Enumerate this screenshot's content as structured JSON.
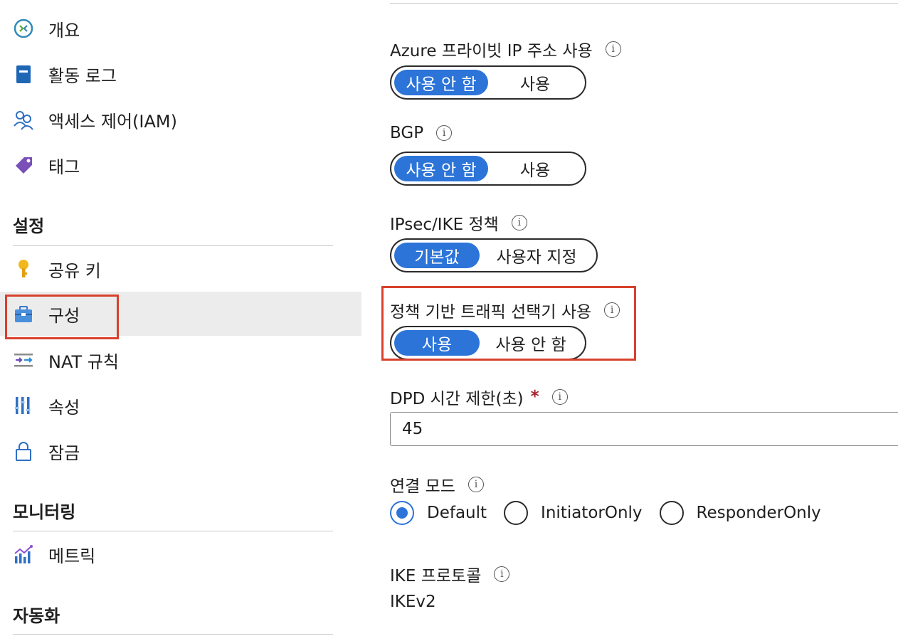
{
  "sidebar": {
    "items_top": [
      {
        "label": "개요",
        "icon": "overview-icon"
      },
      {
        "label": "활동 로그",
        "icon": "activity-log-icon"
      },
      {
        "label": "액세스 제어(IAM)",
        "icon": "access-control-icon"
      },
      {
        "label": "태그",
        "icon": "tag-icon"
      }
    ],
    "settings_title": "설정",
    "settings_items": [
      {
        "label": "공유 키",
        "icon": "key-icon"
      },
      {
        "label": "구성",
        "icon": "configuration-icon",
        "selected": true
      },
      {
        "label": "NAT 규칙",
        "icon": "nat-rules-icon"
      },
      {
        "label": "속성",
        "icon": "properties-icon"
      },
      {
        "label": "잠금",
        "icon": "lock-icon"
      }
    ],
    "monitoring_title": "모니터링",
    "monitoring_items": [
      {
        "label": "메트릭",
        "icon": "metrics-icon"
      }
    ],
    "automation_title": "자동화"
  },
  "main": {
    "private_ip": {
      "label": "Azure 프라이빗 IP 주소 사용",
      "options": [
        "사용 안 함",
        "사용"
      ],
      "selected": "사용 안 함"
    },
    "bgp": {
      "label": "BGP",
      "options": [
        "사용 안 함",
        "사용"
      ],
      "selected": "사용 안 함"
    },
    "ipsec": {
      "label": "IPsec/IKE 정책",
      "options": [
        "기본값",
        "사용자 지정"
      ],
      "selected": "기본값"
    },
    "policy_selector": {
      "label": "정책 기반 트래픽 선택기 사용",
      "options": [
        "사용",
        "사용 안 함"
      ],
      "selected": "사용"
    },
    "dpd": {
      "label": "DPD 시간 제한(초)",
      "required_mark": "*",
      "value": "45"
    },
    "connection_mode": {
      "label": "연결 모드",
      "options": [
        "Default",
        "InitiatorOnly",
        "ResponderOnly"
      ],
      "selected": "Default"
    },
    "ike_protocol": {
      "label": "IKE 프로토콜",
      "value": "IKEv2"
    }
  },
  "colors": {
    "accent": "#2c74d8",
    "highlight_border": "#d8412c",
    "selected_bg": "#ececec"
  }
}
